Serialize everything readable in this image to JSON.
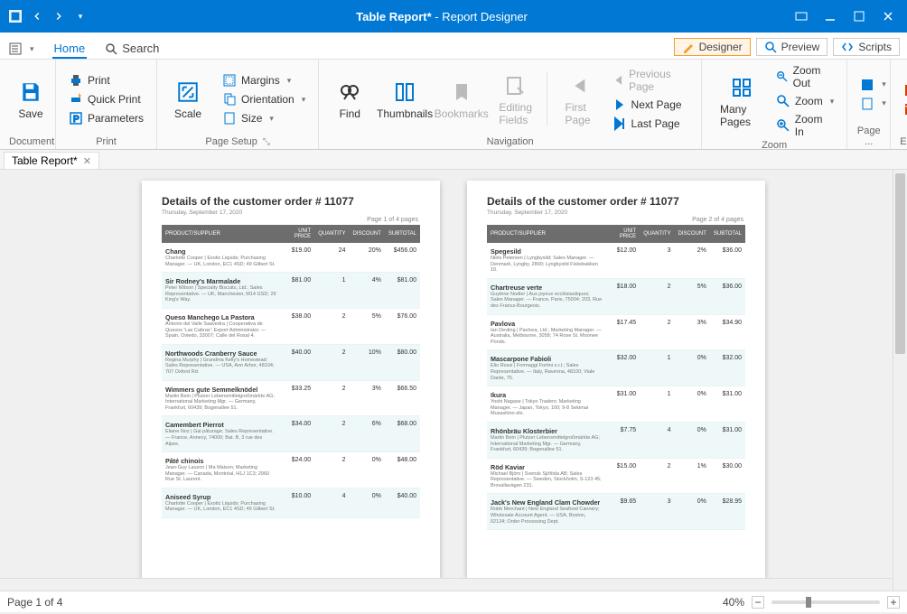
{
  "titlebar": {
    "doc_title": "Table Report*",
    "app_title": " - Report Designer"
  },
  "ribbon_tabs": {
    "home": "Home",
    "search": "Search"
  },
  "modes": {
    "designer": "Designer",
    "preview": "Preview",
    "scripts": "Scripts"
  },
  "ribbon": {
    "document": {
      "save": "Save",
      "group": "Document"
    },
    "print": {
      "print": "Print",
      "quick": "Quick Print",
      "params": "Parameters",
      "group": "Print"
    },
    "pagesetup": {
      "scale": "Scale",
      "margins": "Margins",
      "orientation": "Orientation",
      "size": "Size",
      "group": "Page Setup"
    },
    "nav": {
      "find": "Find",
      "thumbs": "Thumbnails",
      "bookmarks": "Bookmarks",
      "editing": "Editing\nFields",
      "first": "First\nPage",
      "prev": "Previous Page",
      "next": "Next  Page",
      "last": "Last  Page",
      "group": "Navigation"
    },
    "zoom": {
      "many": "Many Pages",
      "out": "Zoom Out",
      "zoom": "Zoom",
      "in": "Zoom In",
      "group": "Zoom"
    },
    "page_group": "Page ...",
    "exp_group": "Exp..."
  },
  "doctab": {
    "name": "Table Report*"
  },
  "report": {
    "title": "Details of the customer order # 11077",
    "date": "Thursday, September 17, 2020",
    "page_label_1": "Page 1 of 4 pages",
    "page_label_2": "Page 2 of 4 pages",
    "headers": {
      "p": "Product/Supplier",
      "up": "Unit Price",
      "q": "Quantity",
      "d": "Discount",
      "s": "Subtotal"
    },
    "page1": [
      {
        "name": "Chang",
        "sub": "Charlotte Cooper | Exotic Liquids; Purchasing Manager. — UK, London, EC1 4SD; 49 Gilbert St.",
        "up": "$19.00",
        "q": "24",
        "d": "20%",
        "s": "$456.00"
      },
      {
        "name": "Sir Rodney's Marmalade",
        "sub": "Peter Wilson | Specialty Biscuits, Ltd.; Sales Representative. — UK, Manchester, M14 GSD; 29 King's Way.",
        "up": "$81.00",
        "q": "1",
        "d": "4%",
        "s": "$81.00"
      },
      {
        "name": "Queso Manchego La Pastora",
        "sub": "Antonio del Valle Saavedra | Cooperativa de Quesos 'Las Cabras'; Export Administrator. — Spain, Oviedo, 33007; Calle del Rosal 4.",
        "up": "$38.00",
        "q": "2",
        "d": "5%",
        "s": "$76.00"
      },
      {
        "name": "Northwoods Cranberry Sauce",
        "sub": "Regina Murphy | Grandma Kelly's Homestead; Sales Representative. — USA, Ann Arbor, 48104; 707 Oxford Rd.",
        "up": "$40.00",
        "q": "2",
        "d": "10%",
        "s": "$80.00"
      },
      {
        "name": "Wimmers gute Semmelknödel",
        "sub": "Martin Bein | Plutzer Lebensmittelgroßmärkte AG; International Marketing Mgr. — Germany, Frankfurt, 60439; Bogenallee 51.",
        "up": "$33.25",
        "q": "2",
        "d": "3%",
        "s": "$66.50"
      },
      {
        "name": "Camembert Pierrot",
        "sub": "Eliane Noz | Gai pâturage; Sales Representative. — France, Annecy, 74000; Bat. B, 3 rue des Alpes.",
        "up": "$34.00",
        "q": "2",
        "d": "6%",
        "s": "$68.00"
      },
      {
        "name": "Pâté chinois",
        "sub": "Jean-Guy Lauzon | Ma Maison; Marketing Manager. — Canada, Montréal, H1J 1C3; 2960 Rue St. Laurent.",
        "up": "$24.00",
        "q": "2",
        "d": "0%",
        "s": "$48.00"
      },
      {
        "name": "Aniseed Syrup",
        "sub": "Charlotte Cooper | Exotic Liquids; Purchasing Manager. — UK, London, EC1 4SD; 49 Gilbert St.",
        "up": "$10.00",
        "q": "4",
        "d": "0%",
        "s": "$40.00"
      }
    ],
    "page2": [
      {
        "name": "Spegesild",
        "sub": "Niels Petersen | Lyngbysild; Sales Manager. — Denmark, Lyngby, 2800; Lyngbysild Fiskebakken 10.",
        "up": "$12.00",
        "q": "3",
        "d": "2%",
        "s": "$36.00"
      },
      {
        "name": "Chartreuse verte",
        "sub": "Guylène Nodier | Aux joyeux ecclésiastiques; Sales Manager. — France, Paris, 75004; 203, Rue des Francs-Bourgeois.",
        "up": "$18.00",
        "q": "2",
        "d": "5%",
        "s": "$36.00"
      },
      {
        "name": "Pavlova",
        "sub": "Ian Devling | Pavlova, Ltd.; Marketing Manager. — Australia, Melbourne, 3058; 74 Rose St. Moonee Ponds.",
        "up": "$17.45",
        "q": "2",
        "d": "3%",
        "s": "$34.90"
      },
      {
        "name": "Mascarpone Fabioli",
        "sub": "Elio Rossi | Formaggi Fortini s.r.l.; Sales Representative. — Italy, Ravenna, 48100; Viale Dante, 75.",
        "up": "$32.00",
        "q": "1",
        "d": "0%",
        "s": "$32.00"
      },
      {
        "name": "Ikura",
        "sub": "Yoshi Nagase | Tokyo Traders; Marketing Manager. — Japan, Tokyo, 100; 9-8 Sekimai Musashino-shi.",
        "up": "$31.00",
        "q": "1",
        "d": "0%",
        "s": "$31.00"
      },
      {
        "name": "Rhönbräu Klosterbier",
        "sub": "Martin Bein | Plutzer Lebensmittelgroßmärkte AG; International Marketing Mgr. — Germany, Frankfurt, 60439; Bogenallee 51.",
        "up": "$7.75",
        "q": "4",
        "d": "0%",
        "s": "$31.00"
      },
      {
        "name": "Röd Kaviar",
        "sub": "Michael Björn | Svensk Sjöföda AB; Sales Representative. — Sweden, Stockholm, S-123 45; Brovallavägen 231.",
        "up": "$15.00",
        "q": "2",
        "d": "1%",
        "s": "$30.00"
      },
      {
        "name": "Jack's New England Clam Chowder",
        "sub": "Robb Merchant | New England Seafood Cannery; Wholesale Account Agent. — USA, Boston, 02134; Order Processing Dept.",
        "up": "$9.65",
        "q": "3",
        "d": "0%",
        "s": "$28.95"
      }
    ]
  },
  "status": {
    "page": "Page 1 of 4",
    "zoom": "40%"
  }
}
